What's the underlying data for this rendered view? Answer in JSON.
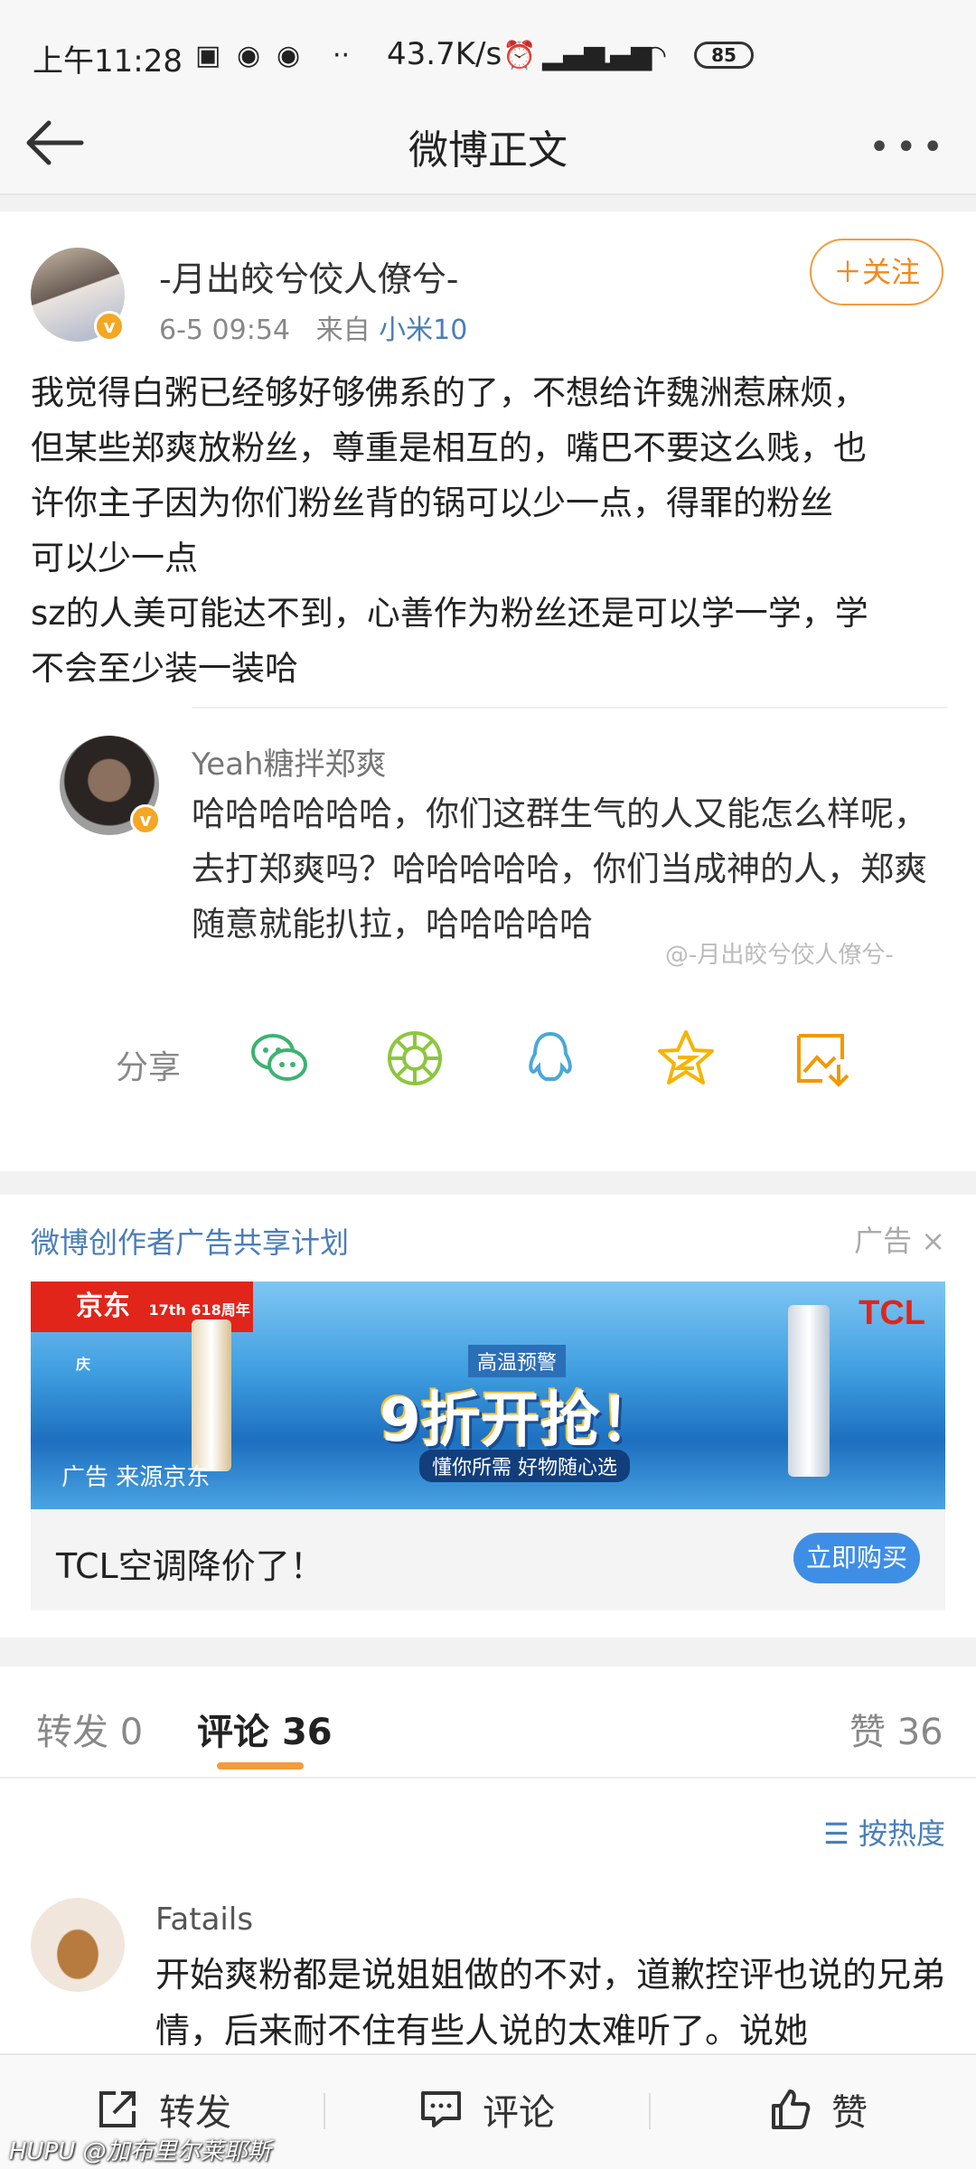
{
  "status_bar": {
    "time": "上午11:28",
    "speed": "43.7K/s",
    "battery": "85"
  },
  "nav": {
    "title": "微博正文"
  },
  "post": {
    "author": "-月出皎兮佼人僚兮-",
    "time": "6-5 09:54",
    "source_prefix": "来自",
    "source": "小米10",
    "follow_label": "＋关注",
    "text": "我觉得白粥已经够好够佛系的了，不想给许魏洲惹麻烦，\n但某些郑爽放粉丝，尊重是相互的，嘴巴不要这么贱，也\n许你主子因为你们粉丝背的锅可以少一点，得罪的粉丝\n可以少一点\nsz的人美可能达不到，心善作为粉丝还是可以学一学，学\n不会至少装一装哈",
    "quote": {
      "author": "Yeah糖拌郑爽",
      "text": "哈哈哈哈哈哈，你们这群生气的人又能怎么样呢，去打郑爽吗？哈哈哈哈哈，你们当成神的人，郑爽随意就能扒拉，哈哈哈哈哈",
      "watermark": "@-月出皎兮佼人僚兮-"
    },
    "share_label": "分享",
    "share_icons": [
      "wechat-icon",
      "moments-icon",
      "qq-icon",
      "qzone-icon",
      "save-image-icon"
    ]
  },
  "ad": {
    "title": "微博创作者广告共享计划",
    "tag": "广告",
    "jd_logo": "京东",
    "jd_anniv": "17th 618周年庆",
    "tcl_logo": "TCL",
    "promo_sub": "高温预警",
    "promo_main": "9折开抢！",
    "promo_tag": "懂你所需 好物随心选",
    "source": "广告 来源京东",
    "caption": "TCL空调降价了！",
    "button": "立即购买"
  },
  "tabs": {
    "repost": "转发",
    "repost_count": "0",
    "comment": "评论",
    "comment_count": "36",
    "like": "赞",
    "like_count": "36"
  },
  "comments": {
    "sort_label": "按热度",
    "items": [
      {
        "author": "Fatails",
        "text": "开始爽粉都是说姐姐做的不对，道歉控评也说的兄弟情，后来耐不住有些人说的太难听了。说她"
      }
    ]
  },
  "bottom_bar": {
    "repost": "转发",
    "comment": "评论",
    "like": "赞"
  },
  "watermark_footer": "HUPU @加布里尔莱耶斯",
  "colors": {
    "accent_orange": "#f29b3f",
    "link_blue": "#4a7eb8",
    "button_blue": "#3e8ee6"
  }
}
